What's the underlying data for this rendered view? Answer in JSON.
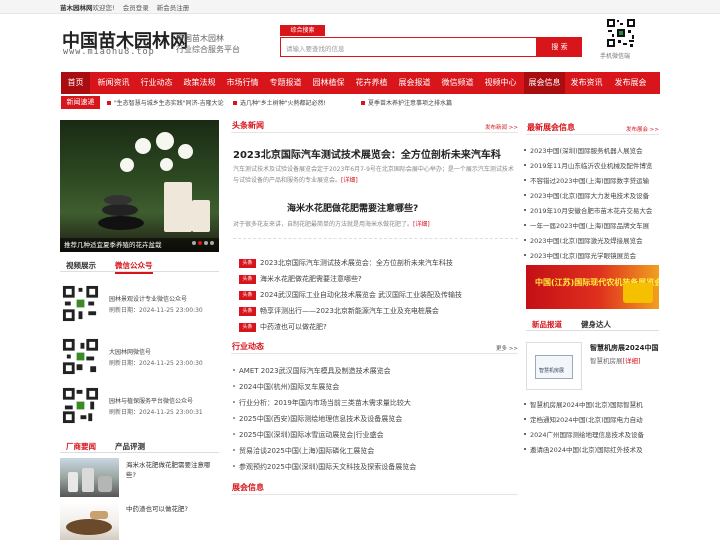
{
  "topbar": {
    "site": "苗木园林网",
    "welcome": "欢迎您!",
    "login": "会员登录",
    "register": "新会员注册"
  },
  "header": {
    "logo": "中国苗木园林网",
    "domain": "www.miaonu8.top",
    "slogan1": "中国苗木园林",
    "slogan2": "行业综合服务平台",
    "search_tag": "综合搜索",
    "search_placeholder": "请输入要查找的信息",
    "search_button": "搜 索",
    "qr_label": "手机微信端"
  },
  "nav": [
    "首页",
    "新闻资讯",
    "行业动态",
    "政策法规",
    "市场行情",
    "专题报道",
    "园林植保",
    "花卉养植",
    "展会报道",
    "微信频道",
    "视频中心",
    "展会信息",
    "发布资讯",
    "发布展会"
  ],
  "nav_active": 11,
  "ticker": {
    "label": "新闻速递",
    "items": [
      "\"生态智慧与城乡生态实践\"同济-吉隆大论",
      "选几种\"乡土树种\"火熱都記必然!",
      "夏季苗木养护注意事项之排水篇"
    ]
  },
  "slideshow": {
    "caption": "推荐几种适宜夏季养殖的花卉盆栽"
  },
  "wechat_tabs": [
    "视频展示",
    "微信公众号"
  ],
  "wechat_items": [
    {
      "name": "园林景观设计专业微信公众号",
      "date": "刷新日期：2024-11-25 23:00:30"
    },
    {
      "name": "大园林网微信号",
      "date": "刷新日期：2024-11-25 23:00:30"
    },
    {
      "name": "园林与植保服务平台微信公众号",
      "date": "刷新日期：2024-11-25 23:00:31"
    }
  ],
  "bottom_left_tabs": [
    "厂商要闻",
    "产品评测"
  ],
  "left_articles": [
    "海米水花肥做花肥需要注意哪些?",
    "中药渣也可以做花肥?"
  ],
  "headlines": {
    "section": "头条新闻",
    "more": "发布新闻 >>",
    "title": "2023北京国际汽车测试技术展览会：全方位剖析未来汽车科",
    "summary": "汽车测试技术及试验设备展览会定于2023年6月7-9号在北京国际会展中心举办；是一个展示汽车测试技术与试验设备的产品和服务的专业展览会。",
    "summary_more": "[详细]",
    "title2": "海米水花肥做花肥需要注意哪些?",
    "summary2": "对于很多花友来讲，自制花肥最简单的方法就是用海米水做花肥了。",
    "summary2_more": "[详细]"
  },
  "tag_label": "头条",
  "tagged_news": [
    "2023北京国际汽车测试技术展览会：全方位剖析未来汽车科技",
    "海米水花肥做花肥需要注意哪些?",
    "2024武汉国际工业自动化技术展览会 武汉国际工业装配及传输技",
    "畅享评测出行——2023北京新能源汽车工业及充电桩展会",
    "中药渣也可以做花肥?"
  ],
  "industry": {
    "section": "行业动态",
    "more": "更多 >>",
    "items": [
      "AMET 2023武汉国际汽车模具及制造技术展览会",
      "2024中国(杭州)国际叉车展览会",
      "行业分析：2019年国内市场当前三类苗木需求量比较大",
      "2025中国(西安)国际测绘地理信息技术及设备展览会",
      "2025中国(深圳)国际冰雪运动展览会|行业盛会",
      "贸易洽谈2025中国(上海)国际磷化工展览会",
      "参观预约2025中国(深圳)国际天文科技及探索设备展览会"
    ]
  },
  "expo_section": "展会信息",
  "latest_expo": {
    "section": "最新展会信息",
    "more": "发布展会 >>",
    "items": [
      "2023中国(深圳)国际服务机器人展览会",
      "2019年11月山东临沂农业机械及配件博览",
      "不容错过2023中国(上海)国际数字贷运输",
      "2023中国(北京)国际大力发电技术及设备",
      "2019年10月安徽合肥市苗木花卉交易大会",
      "一年一届2023中国(上海)国际品牌文车展",
      "2023中国(北京)国际激光及焊接展览会",
      "2023中国(北京)国际光学眼镜展览会"
    ]
  },
  "banner": {
    "text": "中国(江苏)国际现代农机装备展览会"
  },
  "right_tabs": [
    "新品报道",
    "健身达人"
  ],
  "right_feature": {
    "title": "智慧机房展2024中国",
    "summary": "智慧机房展",
    "more": "[详细]",
    "thumb_label": "智慧机房展"
  },
  "right_list": [
    "智慧机房展2024中国(北京)国际智慧机",
    "定档通知2024中国(北京)国际电力自动",
    "2024广州国际测绘地理信息技术及设备",
    "邀请函2024中国(北京)国际红外技术及"
  ],
  "colors": {
    "brand": "#d7151b",
    "nav_active": "#a90d10"
  }
}
